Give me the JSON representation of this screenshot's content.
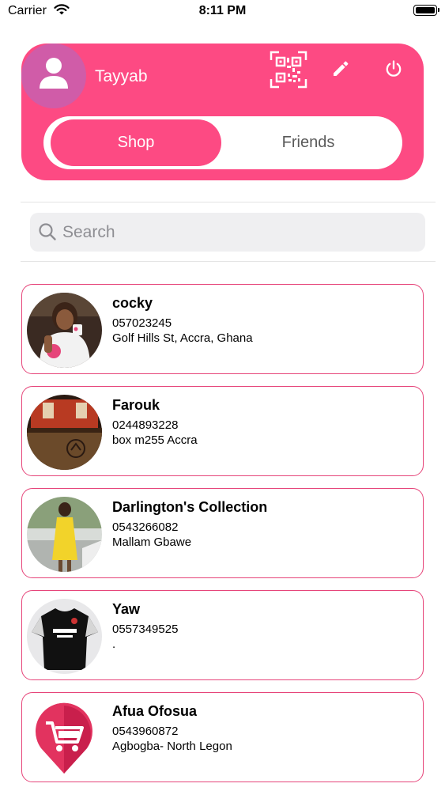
{
  "status_bar": {
    "carrier": "Carrier",
    "time": "8:11 PM"
  },
  "profile": {
    "name": "Tayyab"
  },
  "tabs": [
    {
      "label": "Shop",
      "active": true
    },
    {
      "label": "Friends",
      "active": false
    }
  ],
  "search": {
    "placeholder": "Search"
  },
  "colors": {
    "accent": "#fd4a83",
    "card_border": "#e6457a",
    "avatar_bg": "#d05ca8"
  },
  "shops": [
    {
      "name": "cocky",
      "phone": "057023245",
      "address": "Golf Hills St, Accra, Ghana"
    },
    {
      "name": "Farouk",
      "phone": "0244893228",
      "address": "box m255 Accra"
    },
    {
      "name": "Darlington's Collection",
      "phone": "0543266082",
      "address": "Mallam Gbawe"
    },
    {
      "name": "Yaw",
      "phone": "0557349525",
      "address": "."
    },
    {
      "name": "Afua Ofosua",
      "phone": "0543960872",
      "address": "Agbogba- North Legon"
    }
  ]
}
